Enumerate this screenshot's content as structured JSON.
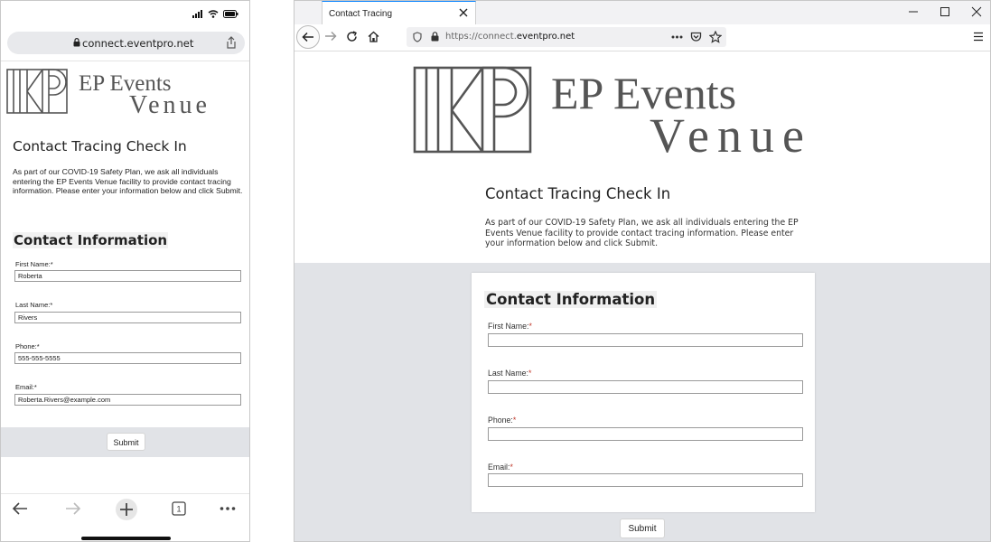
{
  "phone": {
    "url": "connect.eventpro.net",
    "logo": {
      "line1": "EP Events",
      "line2": "Venue"
    },
    "title": "Contact Tracing Check In",
    "intro": "As part of our COVID-19 Safety Plan, we ask all individuals entering the EP Events Venue facility to provide contact tracing information. Please enter your information below and click Submit.",
    "section_title": "Contact Information",
    "fields": [
      {
        "label": "First Name:",
        "required": "*",
        "value": "Roberta"
      },
      {
        "label": "Last Name:",
        "required": "*",
        "value": "Rivers"
      },
      {
        "label": "Phone:",
        "required": "*",
        "value": "555-555-5555"
      },
      {
        "label": "Email:",
        "required": "*",
        "value": "Roberta.Rivers@example.com"
      }
    ],
    "submit_label": "Submit",
    "tab_count": "1"
  },
  "desktop": {
    "tab_title": "Contact Tracing",
    "url_prefix": "https://connect.",
    "url_domain": "eventpro.net",
    "logo": {
      "line1": "EP Events",
      "line2": "Venue"
    },
    "title": "Contact Tracing Check In",
    "intro": "As part of our COVID-19 Safety Plan, we ask all individuals entering the EP Events Venue facility to provide contact tracing information. Please enter your information below and click Submit.",
    "section_title": "Contact Information",
    "fields": [
      {
        "label": "First Name:",
        "required": "*",
        "value": ""
      },
      {
        "label": "Last Name:",
        "required": "*",
        "value": ""
      },
      {
        "label": "Phone:",
        "required": "*",
        "value": ""
      },
      {
        "label": "Email:",
        "required": "*",
        "value": ""
      }
    ],
    "submit_label": "Submit"
  },
  "colors": {
    "accent_tab": "#0a84ff",
    "grey_band": "#e1e3e7",
    "required": "#c0392b",
    "logo": "#555555"
  },
  "icons": [
    "signal-icon",
    "wifi-icon",
    "battery-icon",
    "lock-icon",
    "share-icon",
    "back-arrow-icon",
    "forward-arrow-icon",
    "plus-icon",
    "tabs-icon",
    "more-icon",
    "close-icon",
    "minimize-icon",
    "maximize-icon",
    "reload-icon",
    "home-icon",
    "shield-icon",
    "pocket-icon",
    "star-icon",
    "menu-icon"
  ]
}
